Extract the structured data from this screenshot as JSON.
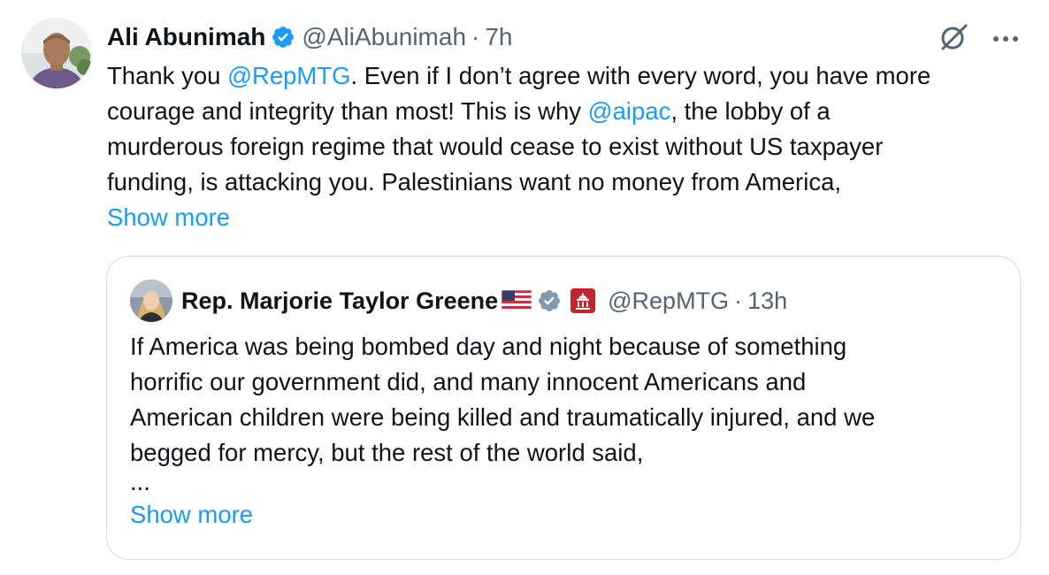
{
  "tweet": {
    "author_name": "Ali Abunimah",
    "handle": "@AliAbunimah",
    "separator": "·",
    "time": "7h",
    "line1_before": "Thank you ",
    "line1_mention": "@RepMTG",
    "line1_after": ". Even if I don’t agree with every word, you have more",
    "line2_before": "courage and integrity than most! This is why ",
    "line2_mention": "@aipac",
    "line2_after": ", the lobby of a",
    "line3": "murderous foreign regime that would cease to exist without US taxpayer",
    "line4": "funding, is attacking you. Palestinians want no money from America,",
    "show_more": "Show more"
  },
  "quote": {
    "author_name": "Rep. Marjorie Taylor Greene",
    "handle": "@RepMTG",
    "separator": "·",
    "time": "13h",
    "lines": [
      "If America was being bombed day and night because of something",
      "horrific our government did, and many innocent Americans and",
      "American children were being killed and traumatically injured, and we",
      "begged for mercy, but the rest of the world said,"
    ],
    "ellipsis": "...",
    "show_more": "Show more"
  },
  "icons": {
    "verified": "verified-badge-icon",
    "grok": "grok-icon",
    "more": "more-options-icon",
    "flag": "us-flag-icon",
    "affiliation": "us-congress-affiliation-icon"
  },
  "colors": {
    "accent": "#1d9bf0",
    "text": "#0f1419",
    "muted": "#536471",
    "border": "#cfd9de",
    "verified_gray": "#829aab"
  }
}
